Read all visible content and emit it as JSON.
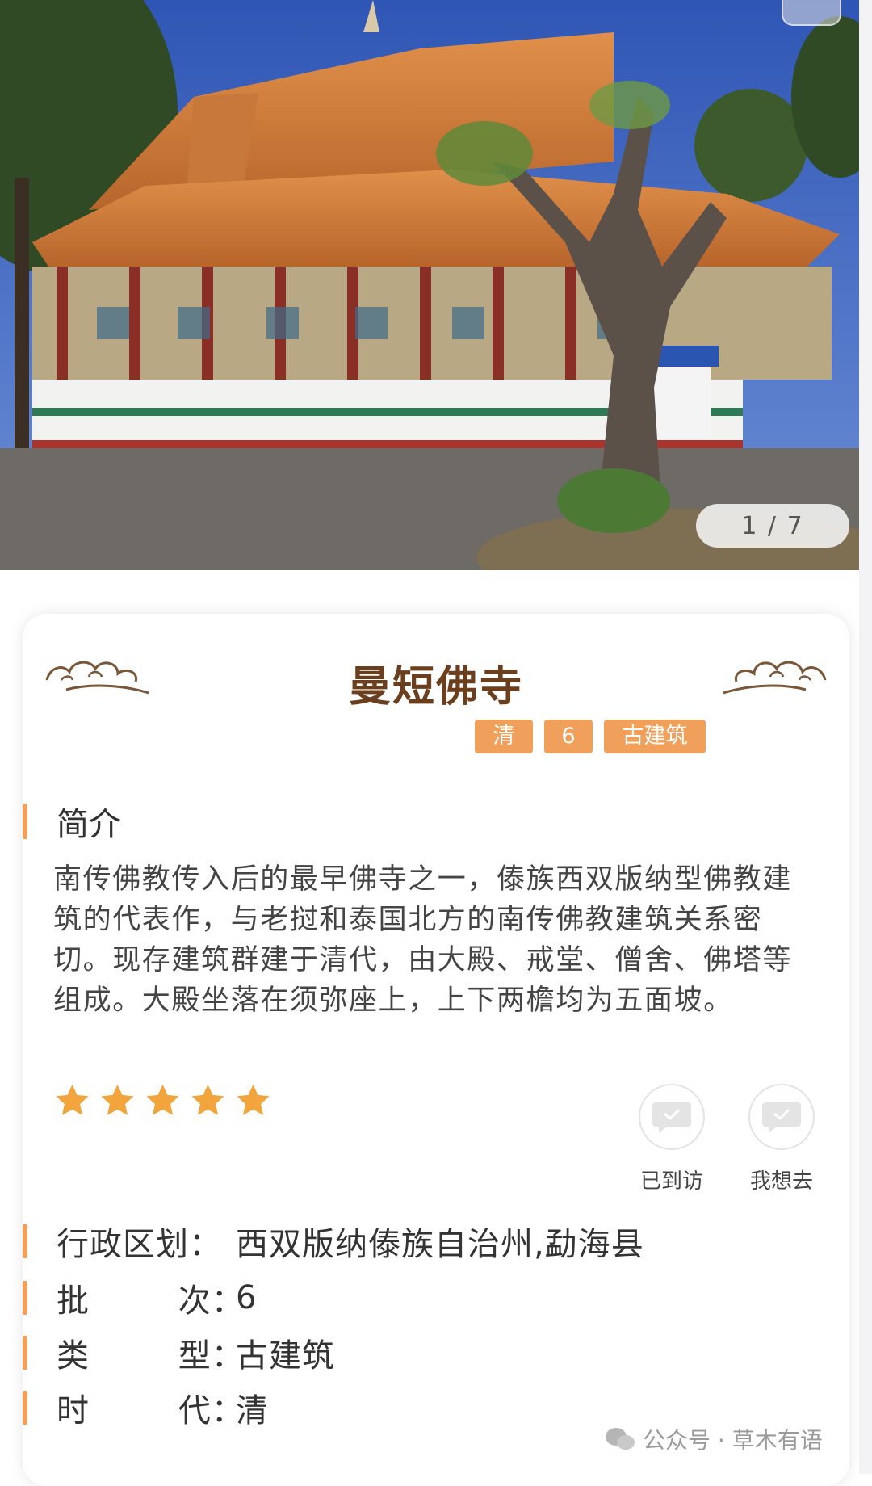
{
  "gallery": {
    "counter": "1 / 7"
  },
  "site": {
    "name": "曼短佛寺",
    "tags": [
      "清",
      "6",
      "古建筑"
    ]
  },
  "intro": {
    "heading": "简介",
    "text": "南传佛教传入后的最早佛寺之一，傣族西双版纳型佛教建筑的代表作，与老挝和泰国北方的南传佛教建筑关系密切。现存建筑群建于清代，由大殿、戒堂、僧舍、佛塔等组成。大殿坐落在须弥座上，上下两檐均为五面坡。"
  },
  "rating": {
    "stars": 5,
    "max": 5
  },
  "actions": {
    "visited": "已到访",
    "want": "我想去"
  },
  "info": [
    {
      "key": "行政区划：",
      "value": "西双版纳傣族自治州,勐海县"
    },
    {
      "key": "批        次：",
      "value": "6"
    },
    {
      "key": "类        型：",
      "value": "古建筑"
    },
    {
      "key": "时        代：",
      "value": "清"
    }
  ],
  "watermark": "公众号 · 草木有语",
  "colors": {
    "accent": "#f0a05a",
    "title": "#6b3f1e",
    "star": "#f2a53c"
  }
}
